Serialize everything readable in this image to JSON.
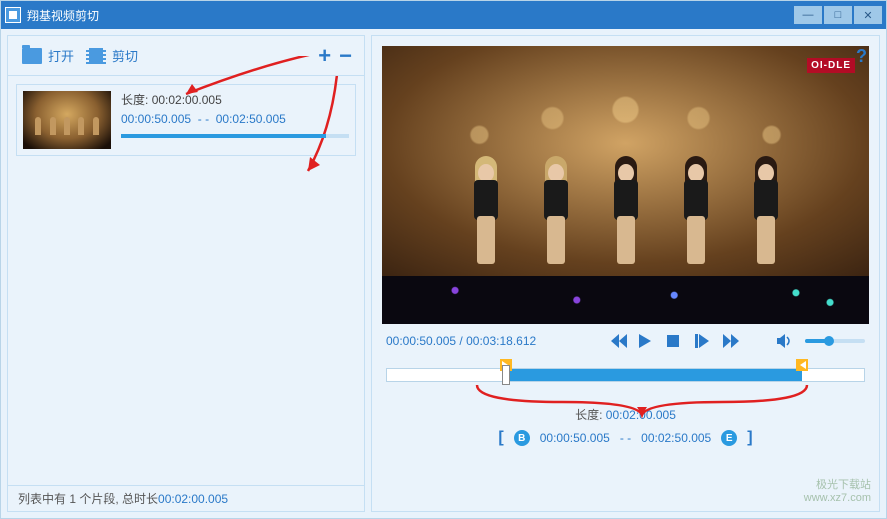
{
  "window": {
    "title": "翔基视频剪切"
  },
  "toolbar": {
    "open_label": "打开",
    "cut_label": "剪切"
  },
  "clip": {
    "duration_label": "长度:",
    "duration": "00:02:00.005",
    "start": "00:00:50.005",
    "sep": "- -",
    "end": "00:02:50.005"
  },
  "status": {
    "prefix": "列表中有 1 个片段, 总时长 ",
    "total": "00:02:00.005"
  },
  "player": {
    "current": "00:00:50.005",
    "sep": "/",
    "total": "00:03:18.612",
    "overlay_logo": "OI-DLE"
  },
  "selection": {
    "duration_label": "长度:",
    "duration": "00:02:00.005",
    "start": "00:00:50.005",
    "sep": "- -",
    "end": "00:02:50.005"
  },
  "watermark": {
    "line1": "极光下载站",
    "line2": "www.xz7.com"
  },
  "icons": {
    "help": "?",
    "plus": "+",
    "minus": "−",
    "bracket_l": "[",
    "bracket_r": "]",
    "badge_b": "B",
    "badge_e": "E"
  }
}
